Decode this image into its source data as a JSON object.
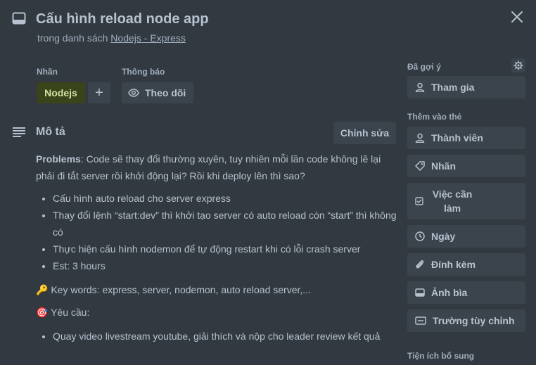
{
  "card": {
    "title": "Cấu hình reload node app",
    "list_prefix": "trong danh sách",
    "list_name": "Nodejs - Express"
  },
  "labels_section": {
    "label_heading": "Nhãn",
    "label_value": "Nodejs",
    "add_label": "+",
    "notify_heading": "Thông báo",
    "watch_label": "Theo dõi"
  },
  "description": {
    "heading": "Mô tả",
    "edit_label": "Chỉnh sửa",
    "problems_bold": "Problems",
    "problems_text": ": Code sẽ thay đổi thường xuyên, tuy nhiên mỗi lần code không lẽ lại phải đi tắt server rồi khởi động lại? Rồi khi deploy lên thì sao?",
    "bullets": [
      "Cấu hình auto reload cho server express",
      "Thay đổi lệnh “start:dev” thì khởi tạo server có auto reload còn “start” thì không có",
      "Thực hiện cấu hình nodemon để tự động restart khi có lỗi crash server",
      "Est: 3 hours"
    ],
    "keywords_emoji": "🔑",
    "keywords_text": "Key words: express, server, nodemon, auto reload server,...",
    "request_emoji": "🎯",
    "request_text": "Yêu cầu:",
    "request_bullets": [
      "Quay video livestream youtube, giải thích và nộp cho leader review kết quả"
    ]
  },
  "sidebar": {
    "suggested_heading": "Đã gợi ý",
    "join_label": "Tham gia",
    "add_to_card_heading": "Thêm vào thẻ",
    "items": [
      {
        "label": "Thành viên",
        "icon": "person-icon"
      },
      {
        "label": "Nhãn",
        "icon": "tag-icon"
      },
      {
        "label": "Việc cần làm",
        "icon": "checklist-icon"
      },
      {
        "label": "Ngày",
        "icon": "clock-icon"
      },
      {
        "label": "Đính kèm",
        "icon": "paperclip-icon"
      },
      {
        "label": "Ảnh bìa",
        "icon": "card-cover-icon"
      },
      {
        "label": "Trường tùy chỉnh",
        "icon": "custom-field-icon"
      }
    ],
    "powerups_heading": "Tiện ích bổ sung"
  },
  "colors": {
    "background": "#323940",
    "button": "#3b444c",
    "label_green_bg": "#39441a",
    "label_green_text": "#d2e4a5",
    "text": "#b6c2cf",
    "muted_text": "#9fadbc"
  }
}
